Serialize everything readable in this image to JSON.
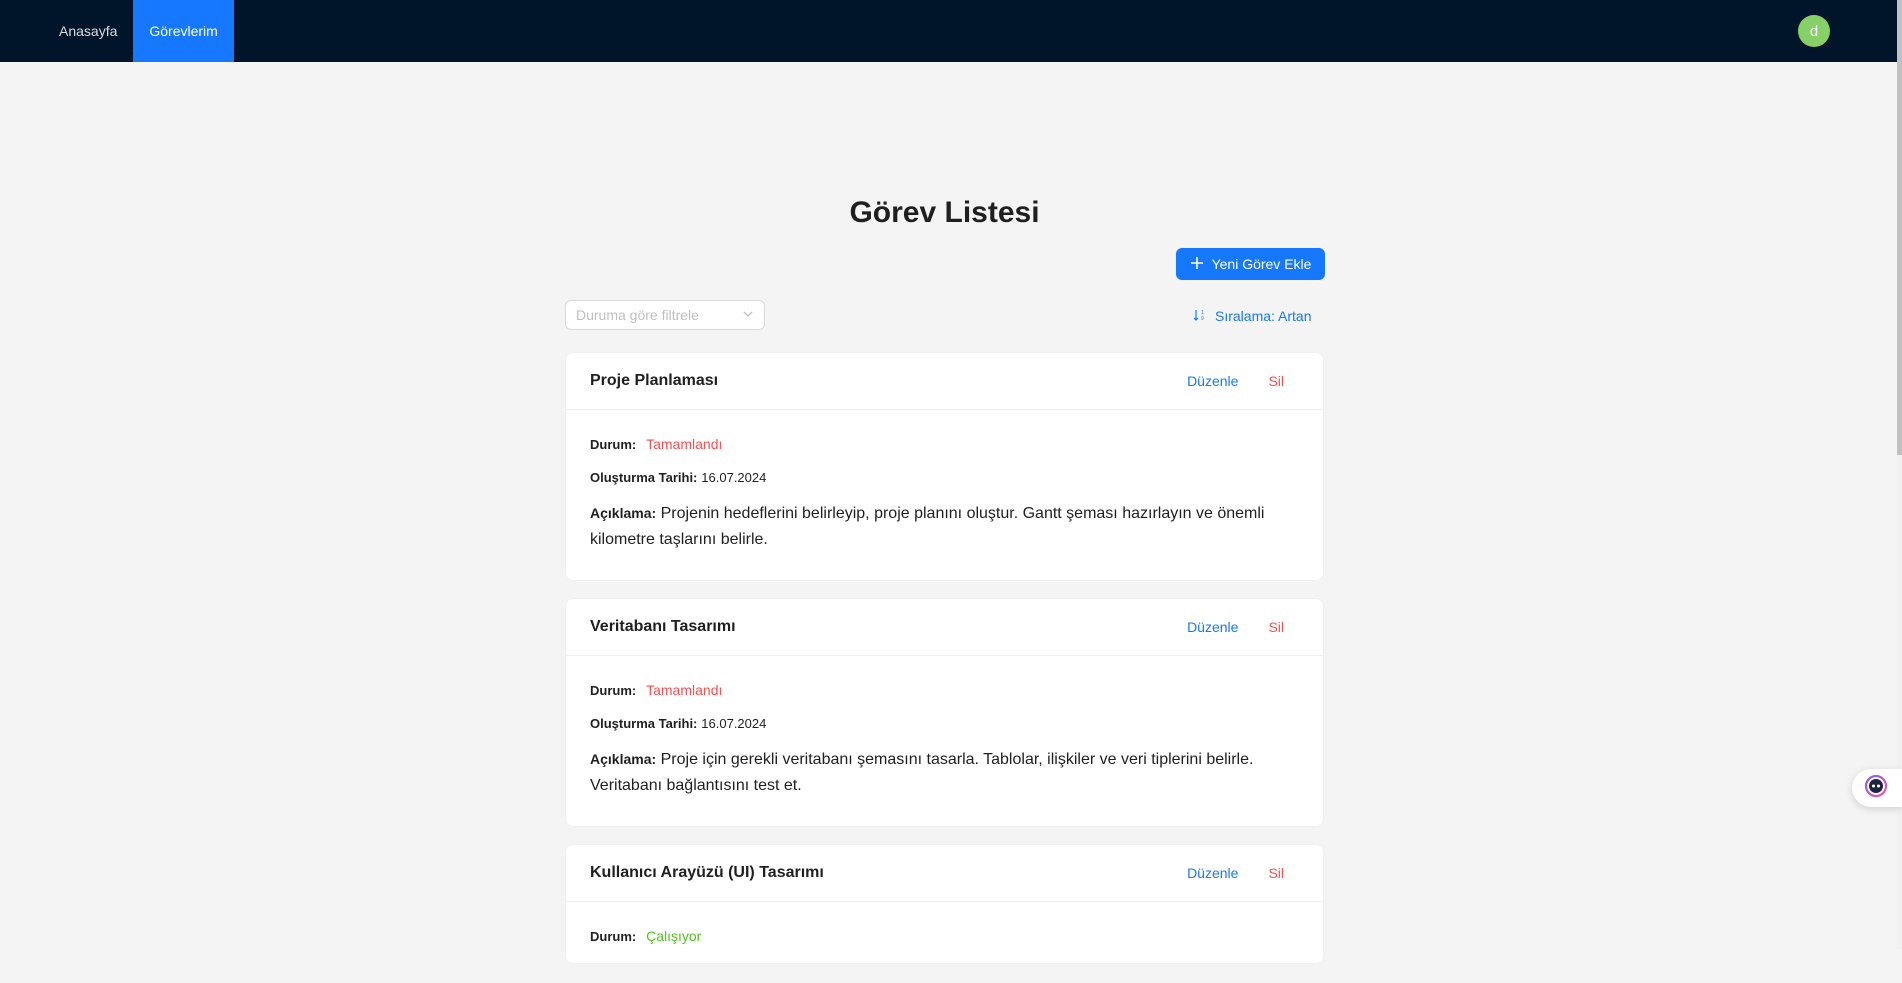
{
  "nav": {
    "items": [
      {
        "label": "Anasayfa",
        "active": false
      },
      {
        "label": "Görevlerim",
        "active": true
      }
    ],
    "avatar_initial": "d",
    "avatar_color": "#87d068",
    "bar_color": "#001529",
    "active_color": "#1677ff"
  },
  "page": {
    "title": "Görev Listesi",
    "add_button_label": "Yeni Görev Ekle",
    "filter_placeholder": "Duruma göre filtrele",
    "sort_label": "Sıralama: Artan"
  },
  "labels": {
    "status": "Durum:",
    "created": "Oluşturma Tarihi:",
    "description": "Açıklama:",
    "edit": "Düzenle",
    "delete": "Sil"
  },
  "tasks": [
    {
      "title": "Proje Planlaması",
      "status": "Tamamlandı",
      "status_color": "#ff4d4f",
      "date": "16.07.2024",
      "description": "Projenin hedeflerini belirleyip, proje planını oluştur. Gantt şeması hazırlayın ve önemli kilometre taşlarını belirle."
    },
    {
      "title": "Veritabanı Tasarımı",
      "status": "Tamamlandı",
      "status_color": "#ff4d4f",
      "date": "16.07.2024",
      "description": "Proje için gerekli veritabanı şemasını tasarla. Tablolar, ilişkiler ve veri tiplerini belirle. Veritabanı bağlantısını test et."
    },
    {
      "title": "Kullanıcı Arayüzü (UI) Tasarımı",
      "status": "Çalışıyor",
      "status_color": "#52c41a"
    }
  ]
}
